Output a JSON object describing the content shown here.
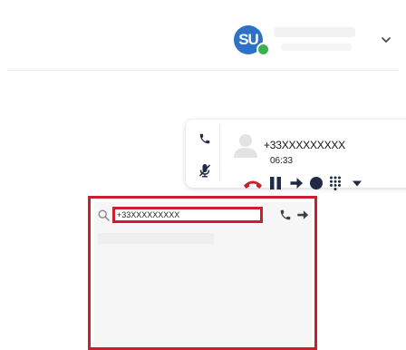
{
  "header": {
    "avatar_initials": "SU",
    "presence_color": "#37b24d",
    "avatar_color": "#2d72c8",
    "menu_icon": "chevron-down-icon"
  },
  "active_call": {
    "number": "+33XXXXXXXXX",
    "duration": "06:33",
    "side_icons": [
      "phone-icon",
      "microphone-muted-icon"
    ],
    "controls": [
      "hangup-icon",
      "pause-icon",
      "arrow-right-icon",
      "record-icon",
      "dialpad-icon",
      "caret-down-icon"
    ],
    "hangup_color": "#cc1f2d"
  },
  "dialer": {
    "search_value": "+33XXXXXXXXX",
    "highlight_color": "#cc1f2d",
    "actions": [
      "phone-icon",
      "arrow-right-icon"
    ]
  }
}
